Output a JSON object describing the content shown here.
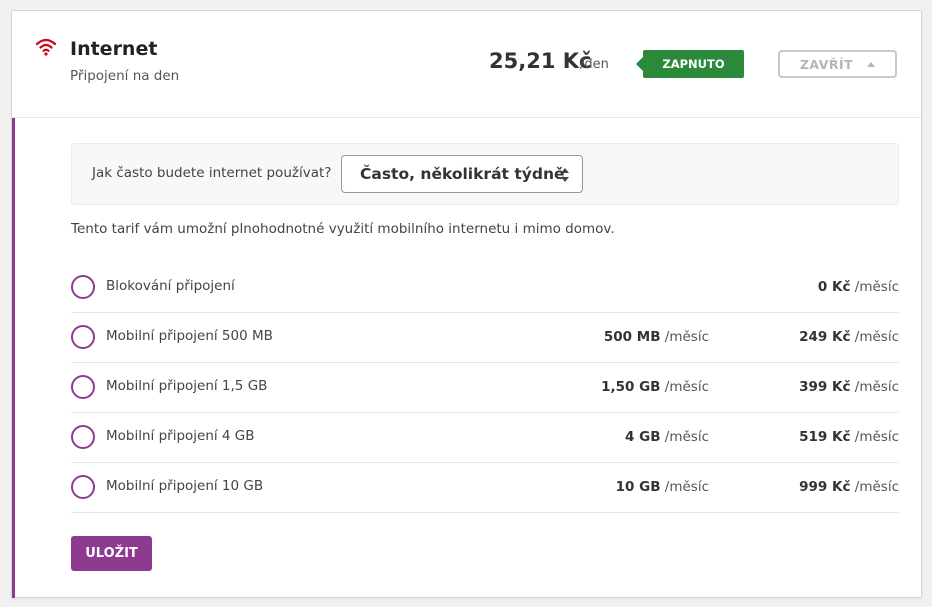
{
  "service": {
    "title": "Internet",
    "subtitle": "Připojení na den",
    "price": "25,21 Kč",
    "price_unit": "/den",
    "status": "ZAPNUTO",
    "close_label": "ZAVŘÍT",
    "wifi_color": "#d0021b",
    "status_color": "#2a8a3a"
  },
  "question": {
    "label": "Jak často budete internet používat?",
    "selected": "Často, několikrát týdně"
  },
  "description": "Tento tarif vám umožní plnohodnotné využití mobilního internetu i mimo domov.",
  "plans": [
    {
      "name": "Blokování připojení",
      "data": "",
      "data_unit": "",
      "price": "0 Kč",
      "price_unit": "/měsíc"
    },
    {
      "name": "Mobilní připojení 500 MB",
      "data": "500 MB",
      "data_unit": "/měsíc",
      "price": "249 Kč",
      "price_unit": "/měsíc"
    },
    {
      "name": "Mobilní připojení 1,5 GB",
      "data": "1,50 GB",
      "data_unit": "/měsíc",
      "price": "399 Kč",
      "price_unit": "/měsíc"
    },
    {
      "name": "Mobilní připojení 4 GB",
      "data": "4 GB",
      "data_unit": "/měsíc",
      "price": "519 Kč",
      "price_unit": "/měsíc"
    },
    {
      "name": "Mobilní připojení 10 GB",
      "data": "10 GB",
      "data_unit": "/měsíc",
      "price": "999 Kč",
      "price_unit": "/měsíc"
    }
  ],
  "save_label": "ULOŽIT",
  "accent_color": "#8e3a91"
}
